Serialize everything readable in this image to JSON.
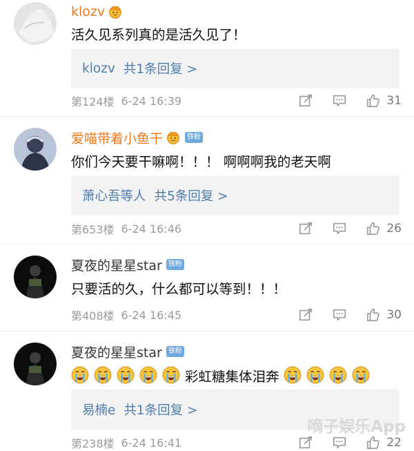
{
  "colors": {
    "username_highlight": "#ef7a1a",
    "link": "#4f7cae",
    "badge": "#6fa8dc",
    "meta": "#9a9a9a"
  },
  "comments": [
    {
      "username": "klozv",
      "text": "活久见系列真的是活久见了！",
      "reply_user": "klozv",
      "reply_count": "共1条回复 >",
      "floor": "第124楼",
      "time": "6-24 16:39",
      "likes": "31"
    },
    {
      "username": "爱喵带着小鱼干",
      "badge": "铁粉",
      "text": "你们今天要干嘛啊！！！ 啊啊啊我的老天啊",
      "reply_user": "萧心吾等人",
      "reply_count": "共5条回复 >",
      "floor": "第653楼",
      "time": "6-24 16:46",
      "likes": "26"
    },
    {
      "username": "夏夜的星星star",
      "badge": "铁粉",
      "text": "只要活的久，什么都可以等到！！！",
      "floor": "第408楼",
      "time": "6-24 16:45",
      "likes": "30"
    },
    {
      "username": "夏夜的星星star",
      "badge": "铁粉",
      "text": "彩虹糖集体泪奔",
      "reply_user": "易楠e",
      "reply_count": "共1条回复 >",
      "floor": "第238楼",
      "time": "6-24 16:41",
      "likes": "22"
    }
  ],
  "watermark": "嘀子娱乐App"
}
